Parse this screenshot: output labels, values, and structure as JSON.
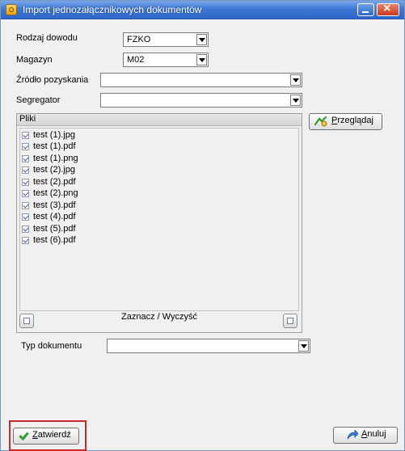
{
  "window": {
    "title": "Import jednozałącznikowych dokumentów"
  },
  "form": {
    "rodzaj_label": "Rodzaj dowodu",
    "rodzaj_value": "FZKO",
    "magazyn_label": "Magazyn",
    "magazyn_value": "M02",
    "zrodlo_label": "Źródło pozyskania",
    "zrodlo_value": "",
    "segregator_label": "Segregator",
    "segregator_value": "",
    "typ_label": "Typ dokumentu",
    "typ_value": ""
  },
  "pliki": {
    "title": "Pliki",
    "files": [
      "test (1).jpg",
      "test (1).pdf",
      "test (1).png",
      "test (2).jpg",
      "test (2).pdf",
      "test (2).png",
      "test (3).pdf",
      "test (4).pdf",
      "test (5).pdf",
      "test (6).pdf"
    ],
    "toggle_label": "Zaznacz / Wyczyść"
  },
  "buttons": {
    "browse_pre": "",
    "browse_u": "P",
    "browse_rest": "rzeglądaj",
    "confirm_u": "Z",
    "confirm_rest": "atwierdź",
    "cancel_u": "A",
    "cancel_rest": "nuluj"
  },
  "icons": [
    "window-app-icon",
    "minimize-icon",
    "close-icon",
    "dropdown-arrow-icon",
    "browse-icon",
    "checkbox-icon",
    "select-all-icon",
    "clear-all-icon",
    "check-icon",
    "cancel-arrow-icon"
  ]
}
